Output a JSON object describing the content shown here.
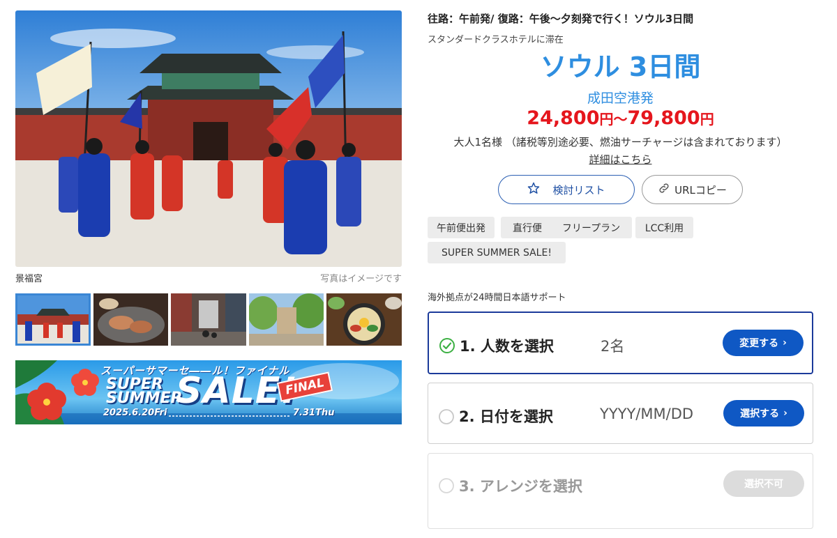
{
  "gallery": {
    "main_caption": "景福宮",
    "image_note": "写真はイメージです",
    "thumbnails": [
      {
        "icon": "palace-guards-photo",
        "selected": true
      },
      {
        "icon": "korean-bbq-photo",
        "selected": false
      },
      {
        "icon": "city-street-photo",
        "selected": false
      },
      {
        "icon": "tree-lined-street-photo",
        "selected": false
      },
      {
        "icon": "bibimbap-photo",
        "selected": false
      }
    ]
  },
  "banner": {
    "line1": "スーパーサマーセ――ル！ファイナル",
    "super": "SUPER",
    "summer": "SUMMER",
    "sale": "SALE!",
    "final": "FINAL",
    "date_start": "2025.6.20Fri",
    "date_end": "7.31Thu"
  },
  "tour": {
    "title": "往路：午前発/ 復路：午後～夕刻発で行く！ソウル3日間",
    "hotel_class": "スタンダードクラスホテルに滞在",
    "destination": "ソウル 3日間",
    "departure": "成田空港発",
    "price_low": "24,800",
    "price_sep": "～",
    "price_high": "79,800",
    "price_unit": "円",
    "per_person": "大人1名様 （諸税等別途必要、燃油サーチャージは含まれております）",
    "details_link": "詳細はこちら"
  },
  "actions": {
    "wishlist_label": "検討リスト",
    "url_copy_label": "URLコピー"
  },
  "tags": [
    "午前便出発",
    "直行便",
    "フリープラン",
    "LCC利用",
    "SUPER SUMMER SALE!"
  ],
  "support_note": "海外拠点が24時間日本語サポート",
  "steps": [
    {
      "label": "1. 人数を選択",
      "value": "2名",
      "button": "変更する",
      "done": true
    },
    {
      "label": "2. 日付を選択",
      "value": "YYYY/MM/DD",
      "button": "選択する",
      "done": false
    },
    {
      "label": "3. アレンジを選択",
      "value": "",
      "button": "選択不可",
      "done": false
    }
  ],
  "colors": {
    "accent_blue": "#2e8ee0",
    "price_red": "#e5161d",
    "button_blue": "#0f58c4",
    "check_green": "#3cb043"
  }
}
